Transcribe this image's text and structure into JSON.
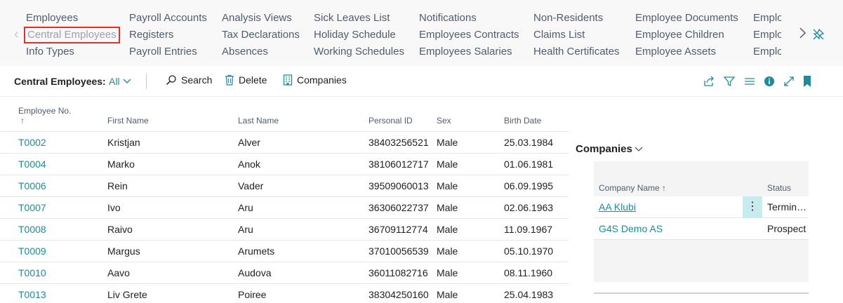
{
  "nav": {
    "columns": [
      [
        "Employees",
        "Central Employees",
        "Info Types"
      ],
      [
        "Payroll Accounts",
        "Registers",
        "Payroll Entries"
      ],
      [
        "Analysis Views",
        "Tax Declarations",
        "Absences"
      ],
      [
        "Sick Leaves List",
        "Holiday Schedule",
        "Working Schedules"
      ],
      [
        "Notifications",
        "Employees Contracts",
        "Employees Salaries"
      ],
      [
        "Non-Residents",
        "Claims List",
        "Health Certificates"
      ],
      [
        "Employee Documents",
        "Employee Children",
        "Employee Assets"
      ],
      [
        "Employe",
        "Employe",
        "Employe"
      ]
    ],
    "active": "Central Employees"
  },
  "actionbar": {
    "page_title": "Central Employees:",
    "view_filter": "All",
    "search_label": "Search",
    "delete_label": "Delete",
    "companies_label": "Companies"
  },
  "grid": {
    "headers": {
      "employee_no": "Employee No.",
      "sort_arrow": "↑",
      "first_name": "First Name",
      "last_name": "Last Name",
      "personal_id": "Personal ID",
      "sex": "Sex",
      "birth_date": "Birth Date"
    },
    "rows": [
      {
        "no": "T0002",
        "first": "Kristjan",
        "last": "Alver",
        "pid": "38403256521",
        "sex": "Male",
        "birth": "25.03.1984"
      },
      {
        "no": "T0004",
        "first": "Marko",
        "last": "Anok",
        "pid": "38106012717",
        "sex": "Male",
        "birth": "01.06.1981"
      },
      {
        "no": "T0006",
        "first": "Rein",
        "last": "Vader",
        "pid": "39509060013",
        "sex": "Male",
        "birth": "06.09.1995"
      },
      {
        "no": "T0007",
        "first": "Ivo",
        "last": "Aru",
        "pid": "36306022737",
        "sex": "Male",
        "birth": "02.06.1963"
      },
      {
        "no": "T0008",
        "first": "Raivo",
        "last": "Aru",
        "pid": "36709112774",
        "sex": "Male",
        "birth": "11.09.1967"
      },
      {
        "no": "T0009",
        "first": "Margus",
        "last": "Arumets",
        "pid": "37010056539",
        "sex": "Male",
        "birth": "05.10.1970"
      },
      {
        "no": "T0010",
        "first": "Aavo",
        "last": "Audova",
        "pid": "36011082716",
        "sex": "Male",
        "birth": "08.11.1960"
      },
      {
        "no": "T0013",
        "first": "Liv Grete",
        "last": "Poiree",
        "pid": "38304250160",
        "sex": "Male",
        "birth": "25.04.1983"
      }
    ]
  },
  "factbox": {
    "title": "Companies",
    "headers": {
      "company_name": "Company Name ↑",
      "status": "Status"
    },
    "rows": [
      {
        "name": "AA Klubi",
        "status": "Terminated",
        "selected": true
      },
      {
        "name": "G4S Demo AS",
        "status": "Prospect",
        "selected": false
      }
    ]
  },
  "colors": {
    "accent": "#1f8a99",
    "highlight_border": "#e0302a",
    "nav_background": "#f8f8f8",
    "factbox_background": "#f4f4f4",
    "selected_cell": "#c7ebee"
  }
}
